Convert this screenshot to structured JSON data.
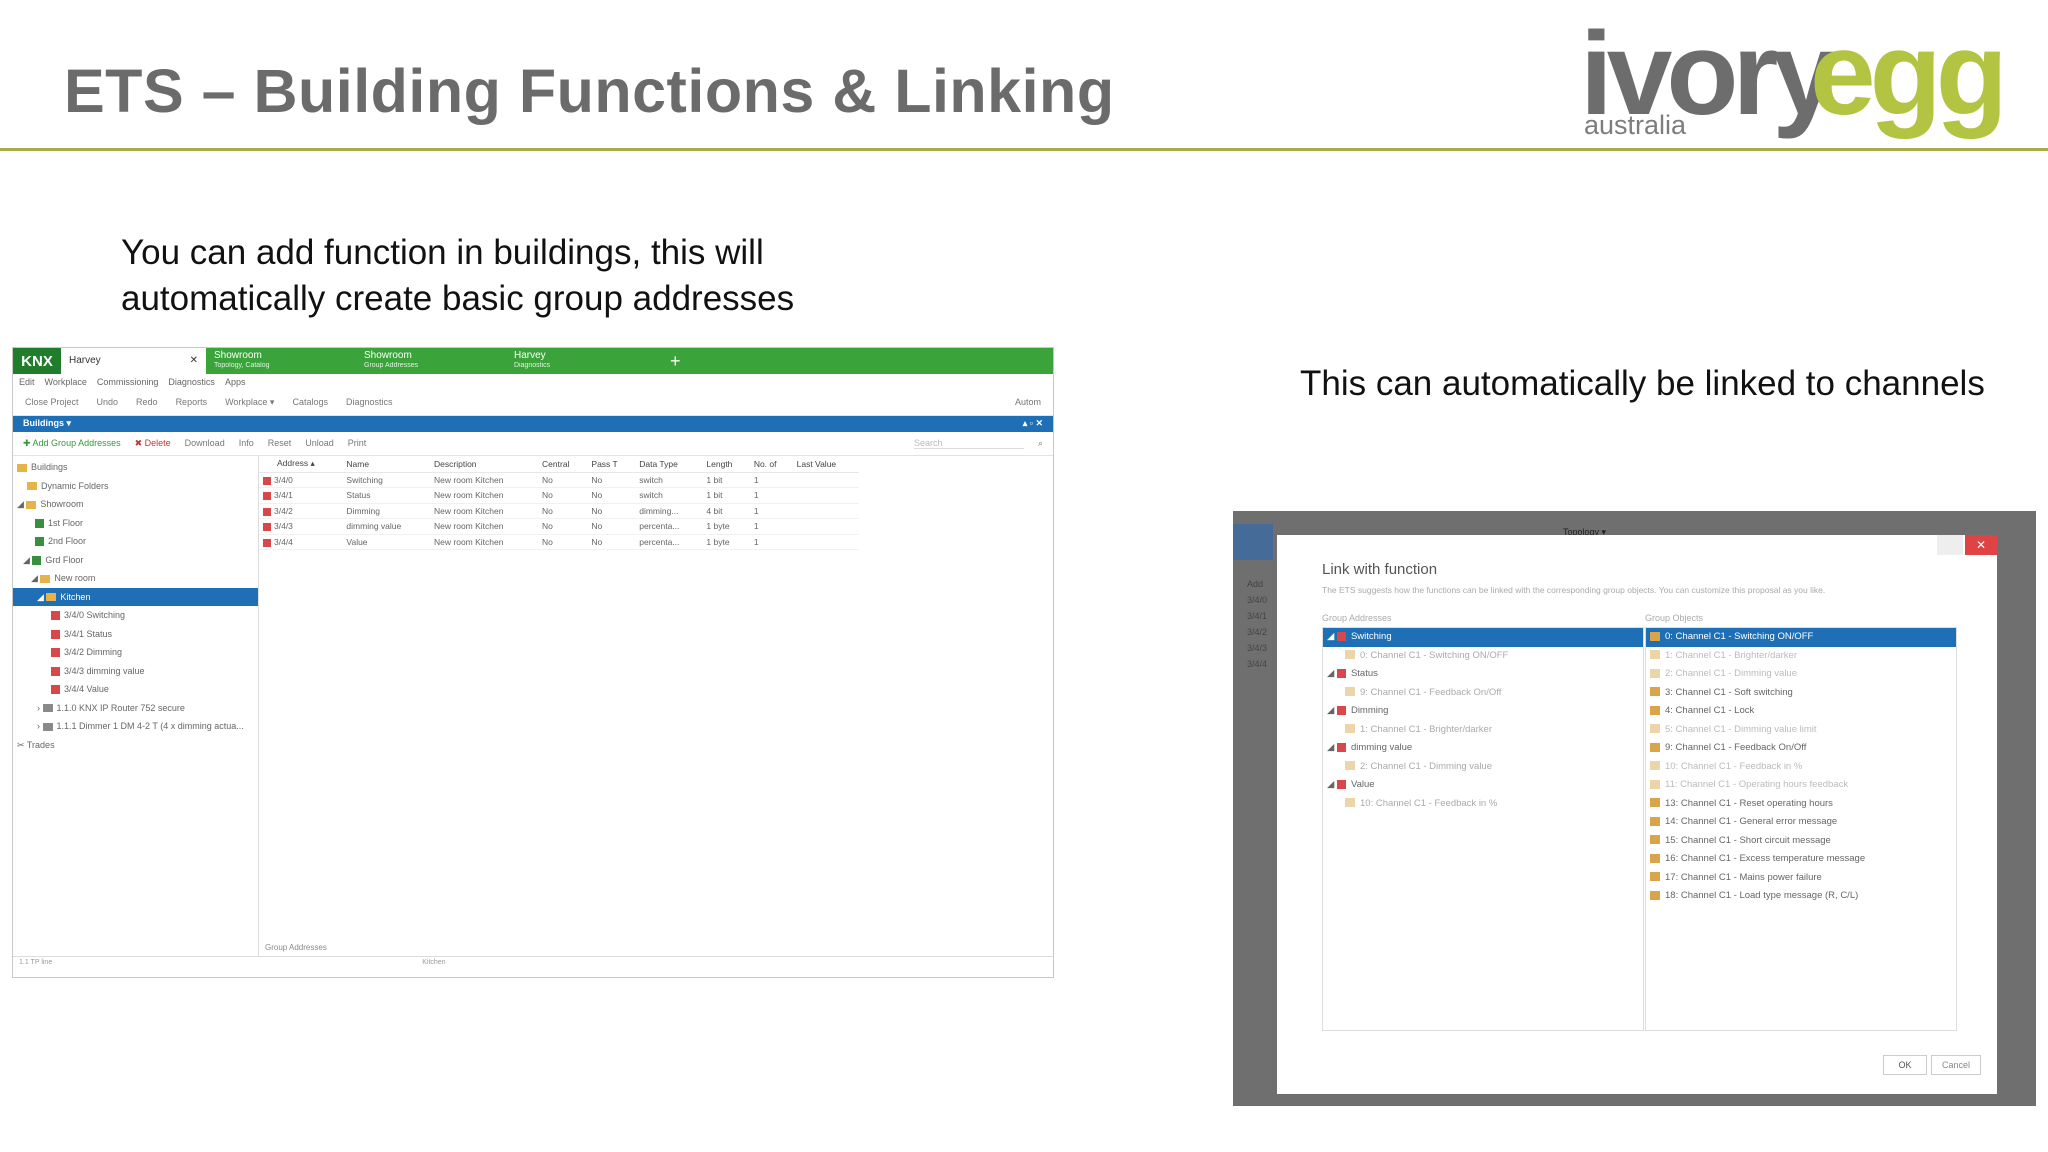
{
  "slide": {
    "title": "ETS – Building Functions & Linking",
    "logo_part1": "ivory",
    "logo_part2": "egg",
    "logo_sub": "australia",
    "caption_left": "You can add function in buildings, this will automatically create basic group addresses",
    "caption_right": "This can automatically be linked to channels"
  },
  "colors": {
    "accent": "#a7ad4a",
    "ets_green": "#3aa43a",
    "ets_blue": "#1e6fb5",
    "brand_green": "#b3c443"
  },
  "ets": {
    "logo": "KNX",
    "tabs": [
      {
        "label": "Harvey",
        "sub": ""
      },
      {
        "label": "Showroom",
        "sub": "Topology, Catalog"
      },
      {
        "label": "Showroom",
        "sub": "Group Addresses"
      },
      {
        "label": "Harvey",
        "sub": "Diagnostics"
      }
    ],
    "menu": [
      "Edit",
      "Workplace",
      "Commissioning",
      "Diagnostics",
      "Apps"
    ],
    "toolbar": [
      "Close Project",
      "Undo",
      "Redo",
      "Reports",
      "Workplace ▾",
      "Catalogs",
      "Diagnostics",
      "Autom"
    ],
    "panel_title": "Buildings ▾",
    "actions": {
      "add": "Add Group Addresses",
      "delete": "Delete",
      "download": "Download",
      "info": "Info",
      "reset": "Reset",
      "unload": "Unload",
      "print": "Print",
      "search": "Search"
    },
    "tree": [
      {
        "label": "Buildings"
      },
      {
        "label": "Dynamic Folders"
      },
      {
        "label": "Showroom"
      },
      {
        "label": "1st Floor"
      },
      {
        "label": "2nd Floor"
      },
      {
        "label": "Grd Floor"
      },
      {
        "label": "New room"
      },
      {
        "label": "Kitchen"
      },
      {
        "label": "3/4/0 Switching"
      },
      {
        "label": "3/4/1 Status"
      },
      {
        "label": "3/4/2 Dimming"
      },
      {
        "label": "3/4/3 dimming value"
      },
      {
        "label": "3/4/4 Value"
      },
      {
        "label": "1.1.0 KNX IP Router 752 secure"
      },
      {
        "label": "1.1.1 Dimmer 1 DM 4-2 T (4 x dimming actua..."
      },
      {
        "label": "Trades"
      }
    ],
    "columns": [
      "Address ▴",
      "Name",
      "Description",
      "Central",
      "Pass T",
      "Data Type",
      "Length",
      "No. of",
      "Last Value"
    ],
    "rows": [
      [
        "3/4/0",
        "Switching",
        "New room Kitchen",
        "No",
        "No",
        "switch",
        "1 bit",
        "1",
        ""
      ],
      [
        "3/4/1",
        "Status",
        "New room Kitchen",
        "No",
        "No",
        "switch",
        "1 bit",
        "1",
        ""
      ],
      [
        "3/4/2",
        "Dimming",
        "New room Kitchen",
        "No",
        "No",
        "dimming...",
        "4 bit",
        "1",
        ""
      ],
      [
        "3/4/3",
        "dimming value",
        "New room Kitchen",
        "No",
        "No",
        "percenta...",
        "1 byte",
        "1",
        ""
      ],
      [
        "3/4/4",
        "Value",
        "New room Kitchen",
        "No",
        "No",
        "percenta...",
        "1 byte",
        "1",
        ""
      ]
    ],
    "bottom_tab": "Group Addresses",
    "status_left": "1.1 TP line",
    "status_mid": "Kitchen"
  },
  "dialog": {
    "title": "Link with function",
    "description": "The ETS suggests how the functions can be linked with the corresponding group objects. You can customize this proposal as you like.",
    "left_header": "Group Addresses",
    "right_header": "Group Objects",
    "bg_left_list": [
      "Add",
      "3/4/0",
      "3/4/1",
      "3/4/2",
      "3/4/3",
      "3/4/4"
    ],
    "bg_title": "Topology ▾",
    "group_addresses": [
      {
        "label": "Switching",
        "child": "0: Channel C1 - Switching ON/OFF"
      },
      {
        "label": "Status",
        "child": "9: Channel C1 - Feedback On/Off"
      },
      {
        "label": "Dimming",
        "child": "1: Channel C1 - Brighter/darker"
      },
      {
        "label": "dimming value",
        "child": "2: Channel C1 - Dimming value"
      },
      {
        "label": "Value",
        "child": "10: Channel C1 - Feedback in %"
      }
    ],
    "group_objects": [
      {
        "label": "0: Channel C1 - Switching ON/OFF",
        "state": "selected"
      },
      {
        "label": "1: Channel C1 - Brighter/darker",
        "state": "dim"
      },
      {
        "label": "2: Channel C1 - Dimming value",
        "state": "dim"
      },
      {
        "label": "3: Channel C1 - Soft switching",
        "state": "normal"
      },
      {
        "label": "4: Channel C1 - Lock",
        "state": "normal"
      },
      {
        "label": "5: Channel C1 - Dimming value limit",
        "state": "dim"
      },
      {
        "label": "9: Channel C1 - Feedback On/Off",
        "state": "normal"
      },
      {
        "label": "10: Channel C1 - Feedback in %",
        "state": "dim"
      },
      {
        "label": "11: Channel C1 - Operating hours feedback",
        "state": "dim"
      },
      {
        "label": "13: Channel C1 - Reset operating hours",
        "state": "normal"
      },
      {
        "label": "14: Channel C1 - General error message",
        "state": "normal"
      },
      {
        "label": "15: Channel C1 - Short circuit message",
        "state": "normal"
      },
      {
        "label": "16: Channel C1 - Excess temperature message",
        "state": "normal"
      },
      {
        "label": "17: Channel C1 - Mains power failure",
        "state": "normal"
      },
      {
        "label": "18: Channel C1 - Load type message (R, C/L)",
        "state": "normal"
      }
    ],
    "ok": "OK",
    "cancel": "Cancel"
  }
}
